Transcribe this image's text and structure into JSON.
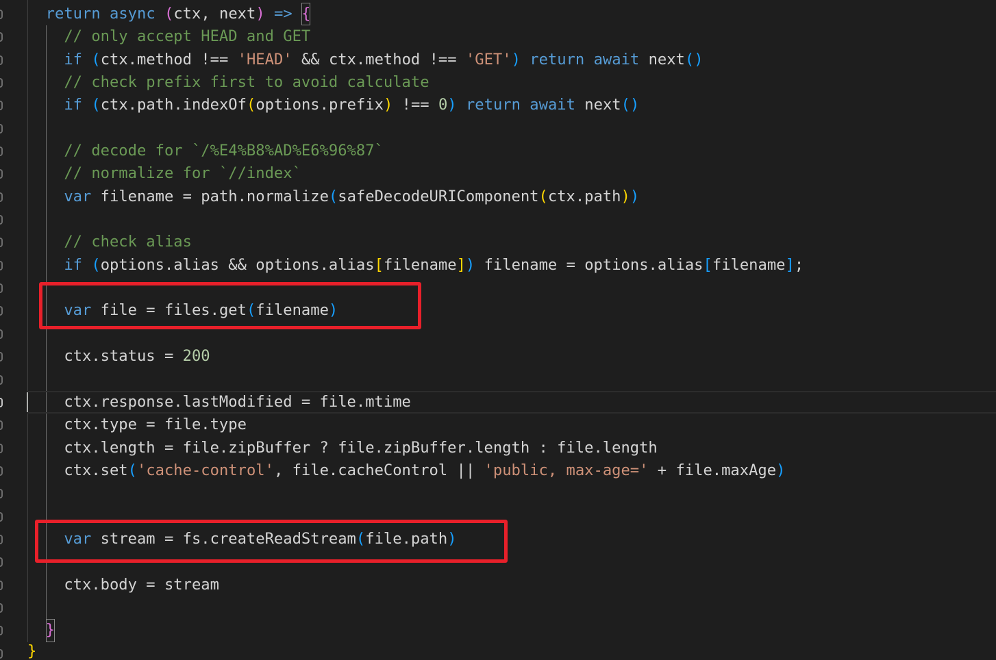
{
  "theme": {
    "background": "#1e1e1e",
    "plain": "#d4d4d4",
    "keyword": "#569cd6",
    "comment": "#6a9955",
    "string": "#ce9178",
    "number": "#b5cea8",
    "bracket-1": "#ffd700",
    "bracket-2": "#da70d6",
    "bracket-3": "#179fff",
    "bracket-match-border": "#888888",
    "indent-guide": "#404040",
    "indent-guide-active": "#707070",
    "line-highlight-border": "#2c2c2c",
    "line-number": "#6e6e6e",
    "line-number-active": "#c6c6c6",
    "cursor": "#aeafad",
    "annotation": "#e8202a"
  },
  "code": {
    "lines": [
      {
        "tokens": [
          {
            "t": "plain",
            "text": "  "
          },
          {
            "t": "keyword",
            "text": "return"
          },
          {
            "t": "plain",
            "text": " "
          },
          {
            "t": "keyword",
            "text": "async"
          },
          {
            "t": "plain",
            "text": " "
          },
          {
            "t": "bracket-2",
            "text": "("
          },
          {
            "t": "plain",
            "text": "ctx, next"
          },
          {
            "t": "bracket-2",
            "text": ")"
          },
          {
            "t": "plain",
            "text": " "
          },
          {
            "t": "keyword",
            "text": "=>"
          },
          {
            "t": "plain",
            "text": " "
          },
          {
            "t": "bracket-2",
            "text": "{",
            "match": true
          }
        ]
      },
      {
        "tokens": [
          {
            "t": "plain",
            "text": "    "
          },
          {
            "t": "comment",
            "text": "// only accept HEAD and GET"
          }
        ]
      },
      {
        "tokens": [
          {
            "t": "plain",
            "text": "    "
          },
          {
            "t": "keyword",
            "text": "if"
          },
          {
            "t": "plain",
            "text": " "
          },
          {
            "t": "bracket-3",
            "text": "("
          },
          {
            "t": "plain",
            "text": "ctx.method !== "
          },
          {
            "t": "string",
            "text": "'HEAD'"
          },
          {
            "t": "plain",
            "text": " && ctx.method !== "
          },
          {
            "t": "string",
            "text": "'GET'"
          },
          {
            "t": "bracket-3",
            "text": ")"
          },
          {
            "t": "plain",
            "text": " "
          },
          {
            "t": "keyword",
            "text": "return"
          },
          {
            "t": "plain",
            "text": " "
          },
          {
            "t": "keyword",
            "text": "await"
          },
          {
            "t": "plain",
            "text": " next"
          },
          {
            "t": "bracket-3",
            "text": "("
          },
          {
            "t": "bracket-3",
            "text": ")"
          }
        ]
      },
      {
        "tokens": [
          {
            "t": "plain",
            "text": "    "
          },
          {
            "t": "comment",
            "text": "// check prefix first to avoid calculate"
          }
        ]
      },
      {
        "tokens": [
          {
            "t": "plain",
            "text": "    "
          },
          {
            "t": "keyword",
            "text": "if"
          },
          {
            "t": "plain",
            "text": " "
          },
          {
            "t": "bracket-3",
            "text": "("
          },
          {
            "t": "plain",
            "text": "ctx.path.indexOf"
          },
          {
            "t": "bracket-1",
            "text": "("
          },
          {
            "t": "plain",
            "text": "options.prefix"
          },
          {
            "t": "bracket-1",
            "text": ")"
          },
          {
            "t": "plain",
            "text": " !== "
          },
          {
            "t": "number",
            "text": "0"
          },
          {
            "t": "bracket-3",
            "text": ")"
          },
          {
            "t": "plain",
            "text": " "
          },
          {
            "t": "keyword",
            "text": "return"
          },
          {
            "t": "plain",
            "text": " "
          },
          {
            "t": "keyword",
            "text": "await"
          },
          {
            "t": "plain",
            "text": " next"
          },
          {
            "t": "bracket-3",
            "text": "("
          },
          {
            "t": "bracket-3",
            "text": ")"
          }
        ]
      },
      {
        "tokens": []
      },
      {
        "tokens": [
          {
            "t": "plain",
            "text": "    "
          },
          {
            "t": "comment",
            "text": "// decode for `/%E4%B8%AD%E6%96%87`"
          }
        ]
      },
      {
        "tokens": [
          {
            "t": "plain",
            "text": "    "
          },
          {
            "t": "comment",
            "text": "// normalize for `//index`"
          }
        ]
      },
      {
        "tokens": [
          {
            "t": "plain",
            "text": "    "
          },
          {
            "t": "keyword",
            "text": "var"
          },
          {
            "t": "plain",
            "text": " filename = path.normalize"
          },
          {
            "t": "bracket-3",
            "text": "("
          },
          {
            "t": "plain",
            "text": "safeDecodeURIComponent"
          },
          {
            "t": "bracket-1",
            "text": "("
          },
          {
            "t": "plain",
            "text": "ctx.path"
          },
          {
            "t": "bracket-1",
            "text": ")"
          },
          {
            "t": "bracket-3",
            "text": ")"
          }
        ]
      },
      {
        "tokens": []
      },
      {
        "tokens": [
          {
            "t": "plain",
            "text": "    "
          },
          {
            "t": "comment",
            "text": "// check alias"
          }
        ]
      },
      {
        "tokens": [
          {
            "t": "plain",
            "text": "    "
          },
          {
            "t": "keyword",
            "text": "if"
          },
          {
            "t": "plain",
            "text": " "
          },
          {
            "t": "bracket-3",
            "text": "("
          },
          {
            "t": "plain",
            "text": "options.alias && options.alias"
          },
          {
            "t": "bracket-1",
            "text": "["
          },
          {
            "t": "plain",
            "text": "filename"
          },
          {
            "t": "bracket-1",
            "text": "]"
          },
          {
            "t": "bracket-3",
            "text": ")"
          },
          {
            "t": "plain",
            "text": " filename = options.alias"
          },
          {
            "t": "bracket-3",
            "text": "["
          },
          {
            "t": "plain",
            "text": "filename"
          },
          {
            "t": "bracket-3",
            "text": "]"
          },
          {
            "t": "plain",
            "text": ";"
          }
        ]
      },
      {
        "tokens": []
      },
      {
        "tokens": [
          {
            "t": "plain",
            "text": "    "
          },
          {
            "t": "keyword",
            "text": "var"
          },
          {
            "t": "plain",
            "text": " file = files.get"
          },
          {
            "t": "bracket-3",
            "text": "("
          },
          {
            "t": "plain",
            "text": "filename"
          },
          {
            "t": "bracket-3",
            "text": ")"
          }
        ]
      },
      {
        "tokens": []
      },
      {
        "tokens": [
          {
            "t": "plain",
            "text": "    "
          },
          {
            "t": "plain",
            "text": "ctx.status = "
          },
          {
            "t": "number",
            "text": "200"
          }
        ]
      },
      {
        "tokens": []
      },
      {
        "active": true,
        "tokens": [
          {
            "t": "plain",
            "text": "    "
          },
          {
            "t": "plain",
            "text": "ctx.response.lastModified = file.mtime"
          }
        ]
      },
      {
        "tokens": [
          {
            "t": "plain",
            "text": "    "
          },
          {
            "t": "plain",
            "text": "ctx.type = file.type"
          }
        ]
      },
      {
        "tokens": [
          {
            "t": "plain",
            "text": "    "
          },
          {
            "t": "plain",
            "text": "ctx.length = file.zipBuffer ? file.zipBuffer.length : file.length"
          }
        ]
      },
      {
        "tokens": [
          {
            "t": "plain",
            "text": "    "
          },
          {
            "t": "plain",
            "text": "ctx.set"
          },
          {
            "t": "bracket-3",
            "text": "("
          },
          {
            "t": "string",
            "text": "'cache-control'"
          },
          {
            "t": "plain",
            "text": ", file.cacheControl || "
          },
          {
            "t": "string",
            "text": "'public, max-age='"
          },
          {
            "t": "plain",
            "text": " + file.maxAge"
          },
          {
            "t": "bracket-3",
            "text": ")"
          }
        ]
      },
      {
        "tokens": []
      },
      {
        "tokens": []
      },
      {
        "tokens": [
          {
            "t": "plain",
            "text": "    "
          },
          {
            "t": "keyword",
            "text": "var"
          },
          {
            "t": "plain",
            "text": " stream = fs.createReadStream"
          },
          {
            "t": "bracket-3",
            "text": "("
          },
          {
            "t": "plain",
            "text": "file.path"
          },
          {
            "t": "bracket-3",
            "text": ")"
          }
        ]
      },
      {
        "tokens": []
      },
      {
        "tokens": [
          {
            "t": "plain",
            "text": "    "
          },
          {
            "t": "plain",
            "text": "ctx.body = stream"
          }
        ]
      },
      {
        "tokens": []
      },
      {
        "tokens": [
          {
            "t": "plain",
            "text": "  "
          },
          {
            "t": "bracket-2",
            "text": "}",
            "match": true
          }
        ]
      },
      {
        "tokens": [
          {
            "t": "bracket-1",
            "text": "}"
          }
        ]
      }
    ]
  }
}
